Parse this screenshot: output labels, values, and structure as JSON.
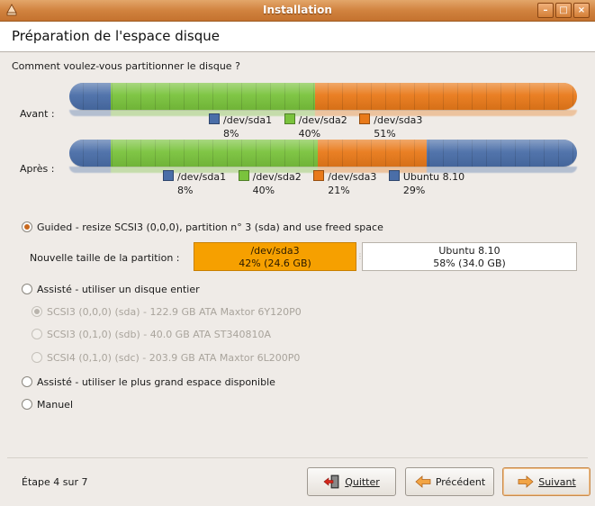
{
  "window": {
    "title": "Installation",
    "controls": [
      "–",
      "□",
      "×"
    ]
  },
  "header": {
    "title": "Préparation de l'espace disque"
  },
  "question": "Comment voulez-vous partitionner le disque ?",
  "before": {
    "label": "Avant :",
    "partitions": [
      {
        "name": "/dev/sda1",
        "pct_label": "8%",
        "pct": 8,
        "color": "#4a6ea8"
      },
      {
        "name": "/dev/sda2",
        "pct_label": "40%",
        "pct": 40,
        "color": "#7ac33d"
      },
      {
        "name": "/dev/sda3",
        "pct_label": "51%",
        "pct": 51,
        "color": "#e97a1a"
      }
    ]
  },
  "after": {
    "label": "Après :",
    "partitions": [
      {
        "name": "/dev/sda1",
        "pct_label": "8%",
        "pct": 8,
        "color": "#4a6ea8"
      },
      {
        "name": "/dev/sda2",
        "pct_label": "40%",
        "pct": 40,
        "color": "#7ac33d"
      },
      {
        "name": "/dev/sda3",
        "pct_label": "21%",
        "pct": 21,
        "color": "#e97a1a"
      },
      {
        "name": "Ubuntu 8.10",
        "pct_label": "29%",
        "pct": 29,
        "color": "#4a6ea8"
      }
    ]
  },
  "options": {
    "guided_resize": "Guided - resize SCSI3 (0,0,0), partition n° 3 (sda) and use freed space",
    "resize_label": "Nouvelle taille de la partition :",
    "resize_left": {
      "name": "/dev/sda3",
      "value": "42% (24.6 GB)",
      "fraction": 0.42
    },
    "resize_right": {
      "name": "Ubuntu 8.10",
      "value": "58% (34.0 GB)"
    },
    "entire_disk": "Assisté - utiliser un disque entier",
    "disks": [
      "SCSI3 (0,0,0) (sda) - 122.9 GB ATA Maxtor 6Y120P0",
      "SCSI3 (0,1,0) (sdb) - 40.0 GB ATA ST340810A",
      "SCSI4 (0,1,0) (sdc) - 203.9 GB ATA Maxtor 6L200P0"
    ],
    "largest_space": "Assisté - utiliser le plus grand espace disponible",
    "manual": "Manuel"
  },
  "footer": {
    "step": "Étape 4 sur 7",
    "quit": "Quitter",
    "previous": "Précédent",
    "next": "Suivant"
  },
  "colors": {
    "accent": "#d1833f",
    "sda1": "#4a6ea8",
    "sda2": "#7ac33d",
    "sda3": "#e97a1a",
    "resize": "#f6a000"
  }
}
